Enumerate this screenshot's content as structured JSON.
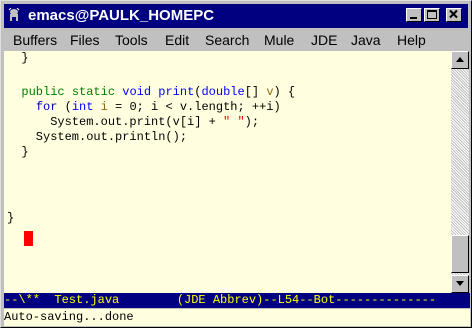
{
  "window": {
    "title": "emacs@PAULK_HOMEPC",
    "app_icon": "emacs-gnu-icon",
    "controls": [
      "minimize-icon",
      "maximize-icon",
      "close-icon"
    ]
  },
  "menubar": {
    "items": [
      "Buffers",
      "Files",
      "Tools",
      "Edit",
      "Search",
      "Mule",
      "JDE",
      "Java",
      "Help"
    ]
  },
  "editor": {
    "lines": [
      [
        {
          "t": "  }",
          "c": ""
        }
      ],
      [
        {
          "t": "",
          "c": ""
        }
      ],
      [
        {
          "t": "  ",
          "c": ""
        },
        {
          "t": "public",
          "c": "mod"
        },
        {
          "t": " ",
          "c": ""
        },
        {
          "t": "static",
          "c": "mod"
        },
        {
          "t": " ",
          "c": ""
        },
        {
          "t": "void",
          "c": "type"
        },
        {
          "t": " ",
          "c": ""
        },
        {
          "t": "print",
          "c": "fn"
        },
        {
          "t": "(",
          "c": ""
        },
        {
          "t": "double",
          "c": "type"
        },
        {
          "t": "[] ",
          "c": ""
        },
        {
          "t": "v",
          "c": "var"
        },
        {
          "t": ") {",
          "c": ""
        }
      ],
      [
        {
          "t": "    ",
          "c": ""
        },
        {
          "t": "for",
          "c": "kw"
        },
        {
          "t": " (",
          "c": ""
        },
        {
          "t": "int",
          "c": "type"
        },
        {
          "t": " ",
          "c": ""
        },
        {
          "t": "i",
          "c": "var"
        },
        {
          "t": " = 0; i < v.length; ++i)",
          "c": ""
        }
      ],
      [
        {
          "t": "      System.out.print(v[i] + ",
          "c": ""
        },
        {
          "t": "\" \"",
          "c": "str"
        },
        {
          "t": ");",
          "c": ""
        }
      ],
      [
        {
          "t": "    System.out.println();",
          "c": ""
        }
      ],
      [
        {
          "t": "  }",
          "c": ""
        }
      ],
      [
        {
          "t": "",
          "c": ""
        }
      ],
      [
        {
          "t": "",
          "c": ""
        }
      ],
      [
        {
          "t": "",
          "c": ""
        }
      ],
      [
        {
          "t": "}",
          "c": ""
        }
      ]
    ],
    "colors": {
      "background": "#ffffe0",
      "cursor": "#ff0000",
      "modifier": "#008000",
      "type": "#0000ff",
      "keyword": "#0000c0",
      "string": "#ff0000",
      "variable": "#8b6914"
    }
  },
  "scrollbar": {
    "up_icon": "scroll-up-arrow-icon",
    "down_icon": "scroll-down-arrow-icon",
    "position": "Bot"
  },
  "modeline": {
    "text": "--\\**  Test.java        (JDE Abbrev)--L54--Bot--------------"
  },
  "minibuffer": {
    "text": "Auto-saving...done"
  }
}
